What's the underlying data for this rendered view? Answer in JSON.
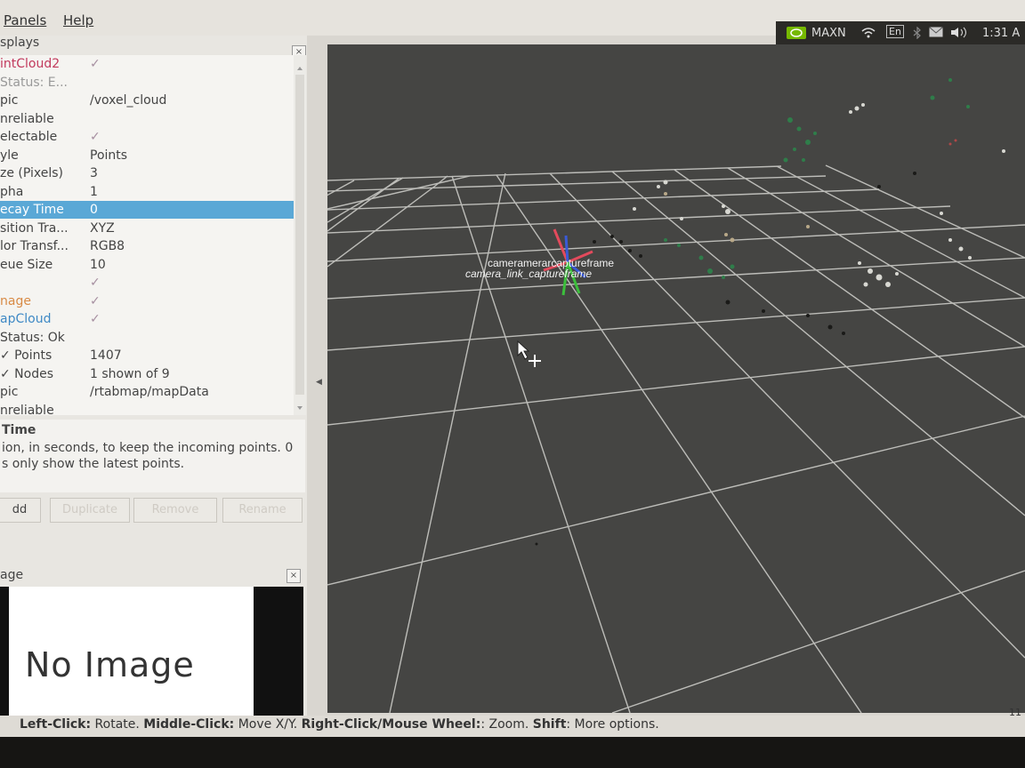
{
  "menu": {
    "panels": "Panels",
    "help": "Help"
  },
  "tray": {
    "power_mode": "MAXN",
    "keyboard": "En",
    "time": "1:31 A"
  },
  "displays_panel": {
    "title": "splays",
    "rows": [
      {
        "key": "intCloud2",
        "value": "✓",
        "style": "red"
      },
      {
        "key": "Status: E...",
        "value": "",
        "style": "gray"
      },
      {
        "key": "pic",
        "value": "/voxel_cloud"
      },
      {
        "key": "nreliable",
        "value": ""
      },
      {
        "key": "electable",
        "value": "✓"
      },
      {
        "key": "yle",
        "value": "Points"
      },
      {
        "key": "ze (Pixels)",
        "value": "3"
      },
      {
        "key": "pha",
        "value": "1"
      },
      {
        "key": "ecay Time",
        "value": "0",
        "style": "sel"
      },
      {
        "key": "sition Tra...",
        "value": "XYZ"
      },
      {
        "key": "lor Transf...",
        "value": "RGB8"
      },
      {
        "key": "eue Size",
        "value": "10"
      },
      {
        "key": "",
        "value": "✓"
      },
      {
        "key": "nage",
        "value": "✓",
        "style": "orange"
      },
      {
        "key": "apCloud",
        "value": "✓",
        "style": "blue"
      },
      {
        "key": "  Status: Ok",
        "value": ""
      },
      {
        "key": "  ✓ Points",
        "value": "1407"
      },
      {
        "key": "  ✓ Nodes",
        "value": "1 shown of 9"
      },
      {
        "key": "pic",
        "value": "/rtabmap/mapData"
      },
      {
        "key": "nreliable",
        "value": ""
      }
    ]
  },
  "description": {
    "title": "Time",
    "line1": "ion, in seconds, to keep the incoming points. 0",
    "line2": "s only show the latest points."
  },
  "buttons": {
    "add": "dd",
    "duplicate": "Duplicate",
    "remove": "Remove",
    "rename": "Rename"
  },
  "image_panel": {
    "title": "age",
    "placeholder": "No Image"
  },
  "view": {
    "frame_label_top": "cameramerarcaptureframe",
    "frame_label_bottom": "camera_link_captureframe"
  },
  "status_bar": {
    "left_click_key": "Left-Click:",
    "left_click_val": " Rotate. ",
    "middle_click_key": "Middle-Click:",
    "middle_click_val": " Move X/Y. ",
    "right_click_key": "Right-Click/Mouse Wheel:",
    "right_click_val": ": Zoom. ",
    "shift_key": "Shift",
    "shift_val": ": More options.",
    "fps": "11"
  },
  "colors": {
    "accent": "#5aa8d6",
    "view_bg": "#454543",
    "grid": "#bdbdb9"
  }
}
